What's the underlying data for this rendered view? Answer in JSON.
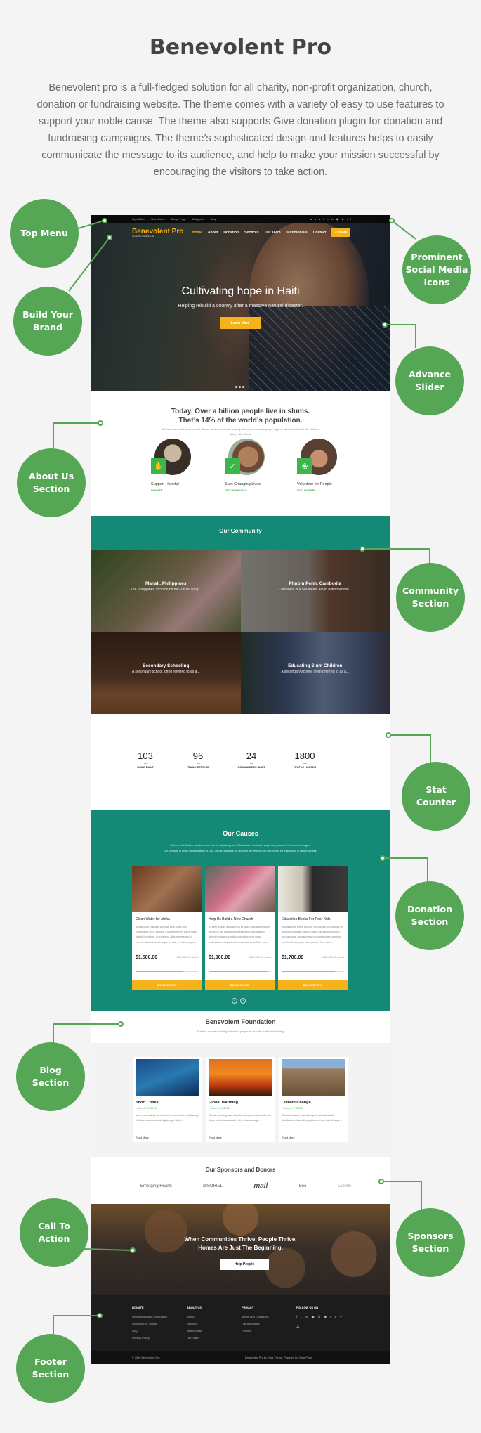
{
  "intro": {
    "title": "Benevolent Pro",
    "description": "Benevolent pro is a full-fledged solution for all charity, non-profit organization, church, donation or fundraising website. The theme comes with a variety of easy to use features  to support your noble cause. The theme also supports Give donation plugin for donation and fundraising campaigns.  The theme’s sophisticated design and features helps to easily communicate the message to its audience, and help to make your mission successful by encouraging the visitors to take action."
  },
  "topbar": {
    "links": [
      "Style Guide",
      "Short Codes",
      "Sample Page",
      "Categories",
      "Shop"
    ],
    "social_icons": [
      "amazon-icon",
      "vimeo-icon",
      "stumbleupon-icon",
      "tumblr-icon",
      "pinterest-icon",
      "linkedin-icon",
      "dribbble-icon",
      "instagram-icon",
      "twitter-icon",
      "facebook-icon"
    ],
    "social_glyphs": [
      "a",
      "v",
      "s",
      "t",
      "p",
      "in",
      "◉",
      "◎",
      "t",
      "f"
    ]
  },
  "navbar": {
    "brand": "Benevolent Pro",
    "tagline": "Just another WordPress site",
    "items": [
      "Home",
      "About",
      "Donation",
      "Services",
      "Our Team",
      "Testimonials",
      "Contact"
    ],
    "active": "Home",
    "donate": "Donate"
  },
  "slider": {
    "title": "Cultivating hope in Haiti",
    "subtitle": "Helping rebuild a country after a massive natural disaster.",
    "button": "Learn More",
    "slides": 3,
    "current": 1
  },
  "about": {
    "heading_line1": "Today, Over a billion people live in slums.",
    "heading_line2": "That’s 14% of the world’s population.",
    "text": "We work over vast areas around all over world to eliminate poverty. We work to provide proper hygiene and education for the children living in the slums.",
    "items": [
      {
        "label": "Support Hopeful",
        "link": "DONATE ›"
      },
      {
        "label": "Start Changing Lives",
        "link": "GET INVOLVED ›"
      },
      {
        "label": "Volunteer for People",
        "link": "VOLUNTEER ›"
      }
    ]
  },
  "community": {
    "title": "Our Community",
    "items": [
      {
        "title": "Manali, Philippines",
        "subtitle": "The Philippines' location on the Pacific Ring..."
      },
      {
        "title": "Phnom Penh, Cambodia",
        "subtitle": "Cambodia is a Southeast Asian nation whose..."
      },
      {
        "title": "Secondary Schooling",
        "subtitle": "A secondary school, often referred to as a..."
      },
      {
        "title": "Educating Slum Children",
        "subtitle": "A secondary school, often referred to as a..."
      }
    ]
  },
  "stats": [
    {
      "value": "103",
      "label": "HOME BUILT"
    },
    {
      "value": "96",
      "label": "FAMILY SETTLED"
    },
    {
      "value": "24",
      "label": "COMMUNITIES BUILT"
    },
    {
      "value": "1800",
      "label": "PEOPLE HOUSED"
    }
  ],
  "causes": {
    "title": "Our Causes",
    "subtitle_line1": "Sed eu orci dictum, condimentum orci et, adipiscing leo. Etiam luctus tincidunt neque non posuere. Praesent eu augue.",
    "subtitle_line2": "All scripture is given by inspiration of God, and is profitable for doctrine, for reproof, for correction, for instruction in righteousness",
    "items": [
      {
        "title": "Clean Water for Afrika",
        "desc": "Vestibulum tristique urna ac erat porta, nec consequat dolor blandit. Fusce eleifend porta turpis blandit tincidunt. In euismod aliquam massa id cursus. Mauris scelerisque mi nisi, ut ullamcorper...",
        "raised": "$1,500.00",
        "goal": "of $2,000.00 raised",
        "progress": 0.75,
        "button": "DONATE NOW"
      },
      {
        "title": "Help Us Build a New Church",
        "desc": "At vero eos et accusamus et iusto odio dignissimos ducimus qui blanditiis praesentium voluptatum deleniti atque corrupti quos dolores et quas molestias excepturi sint occaecati cupiditate non...",
        "raised": "$1,900.00",
        "goal": "of $2,000.00 raised",
        "progress": 0.95,
        "button": "DONATE NOW"
      },
      {
        "title": "Education Books For Poor Kids",
        "desc": "Nor again is there anyone who loves or pursues or desires to obtain pain of itself, because it is pain, but because occasionally circumstances occur in which toil and pain can procure him some...",
        "raised": "$1,700.00",
        "goal": "of $2,000.00 raised",
        "progress": 0.85,
        "button": "DONATE NOW"
      }
    ]
  },
  "blog": {
    "title": "Benevolent Foundation",
    "subtitle": "See how we are reaching millions of people all over the world and helping.",
    "posts": [
      {
        "title": "Short Codes",
        "date": "October 7, 2016",
        "desc": "orem ipsum dolor sit ccomet, consectetuer adipiscing elit. Aenean commodo ligula eget dolor...",
        "more": "Read More"
      },
      {
        "title": "Global Warming",
        "date": "October 7, 2016",
        "desc": "Global warming and climate change are terms for the observed century-scale rise in the average...",
        "more": "Read More"
      },
      {
        "title": "Climate Change",
        "date": "October 7, 2016",
        "desc": "Climate change is a change in the statistical distribution of weather patterns when that change...",
        "more": "Read More"
      }
    ]
  },
  "sponsors": {
    "title": "Our Sponsors and Donors",
    "logos": [
      "Emerging Health",
      "BISORIEL",
      "mail",
      "Bee",
      "Lucelle"
    ]
  },
  "cta": {
    "line1": "When Communities Thrive, People Thrive.",
    "line2": "Homes Are Just The Beginning.",
    "button": "Help People"
  },
  "footer": {
    "columns": [
      {
        "heading": "DONATE",
        "items": [
          "Why Benevolent Foundation",
          "Sponsor Our Cause",
          "FAQ",
          "Privacy Policy"
        ]
      },
      {
        "heading": "ABOUT US",
        "items": [
          "About",
          "Services",
          "Testimonials",
          "Our Team"
        ]
      },
      {
        "heading": "PRIVACY",
        "items": [
          "Terms and Conditions",
          "Full-disclosure",
          "Policies"
        ]
      },
      {
        "heading": "FOLLOW US ON",
        "items": []
      }
    ],
    "social_glyphs": [
      "f",
      "t",
      "◎",
      "▣",
      "in",
      "◉",
      "t",
      "a",
      "V",
      "⁂"
    ],
    "copyright": "© 2016 Benevolent Pro.",
    "credit": "Benevolent Pro by Rara Theme. Powered by: WordPress"
  },
  "annotations": {
    "top_menu": "Top Menu",
    "build_brand": "Build Your Brand",
    "social_icons": "Prominent Social Media Icons",
    "advance_slider": "Advance Slider",
    "about_us": "About Us Section",
    "community": "Community Section",
    "stat_counter": "Stat Counter",
    "donation": "Donation Section",
    "blog": "Blog Section",
    "sponsors": "Sponsors Section",
    "call_to_action": "Call To Action",
    "footer": "Footer Section"
  },
  "colors": {
    "accent_green": "#55a655",
    "teal": "#148a76",
    "brand_yellow": "#f5b21b"
  }
}
